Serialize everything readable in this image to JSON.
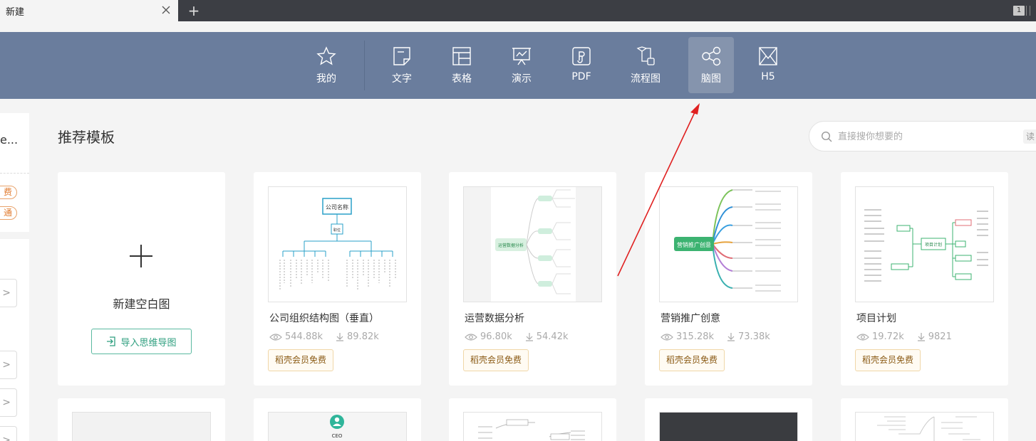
{
  "tab": {
    "title": "新建"
  },
  "window": {
    "badge": "1"
  },
  "categories": [
    {
      "id": "mine",
      "label": "我的",
      "icon": "star-icon"
    },
    {
      "id": "text",
      "label": "文字",
      "icon": "document-icon"
    },
    {
      "id": "sheet",
      "label": "表格",
      "icon": "table-icon"
    },
    {
      "id": "present",
      "label": "演示",
      "icon": "presentation-icon"
    },
    {
      "id": "pdf",
      "label": "PDF",
      "icon": "pdf-icon"
    },
    {
      "id": "flow",
      "label": "流程图",
      "icon": "flowchart-icon"
    },
    {
      "id": "mindmap",
      "label": "脑图",
      "icon": "mindmap-icon",
      "active": true
    },
    {
      "id": "h5",
      "label": "H5",
      "icon": "h5-icon"
    }
  ],
  "left_panel": {
    "text": "e...",
    "pills": [
      "费",
      "通"
    ]
  },
  "main": {
    "section_title": "推荐模板",
    "search": {
      "placeholder": "直接搜你想要的",
      "tag": "读"
    },
    "blank": {
      "title": "新建空白图",
      "import_label": "导入思维导图"
    },
    "templates": [
      {
        "name": "公司组织结构图（垂直）",
        "views": "544.88k",
        "downloads": "89.82k",
        "badge": "稻壳会员免费"
      },
      {
        "name": "运营数据分析",
        "views": "96.80k",
        "downloads": "54.42k",
        "badge": "稻壳会员免费"
      },
      {
        "name": "营销推广创意",
        "views": "315.28k",
        "downloads": "73.38k",
        "badge": "稻壳会员免费"
      },
      {
        "name": "项目计划",
        "views": "19.72k",
        "downloads": "9821",
        "badge": "稻壳会员免费"
      }
    ],
    "thumb_labels": {
      "org_company": "公司名称",
      "org_unit": "职位",
      "ops_center": "运营数据分析",
      "mkt_center": "营销推广创意",
      "proj_center": "项目计划",
      "ceo": "CEO"
    }
  },
  "colors": {
    "nav_bg": "#6a7d9d",
    "nav_active": "#8594ad",
    "accent_green": "#2f9f7f",
    "badge_text": "#8a5a14",
    "arrow_red": "#e02020"
  }
}
